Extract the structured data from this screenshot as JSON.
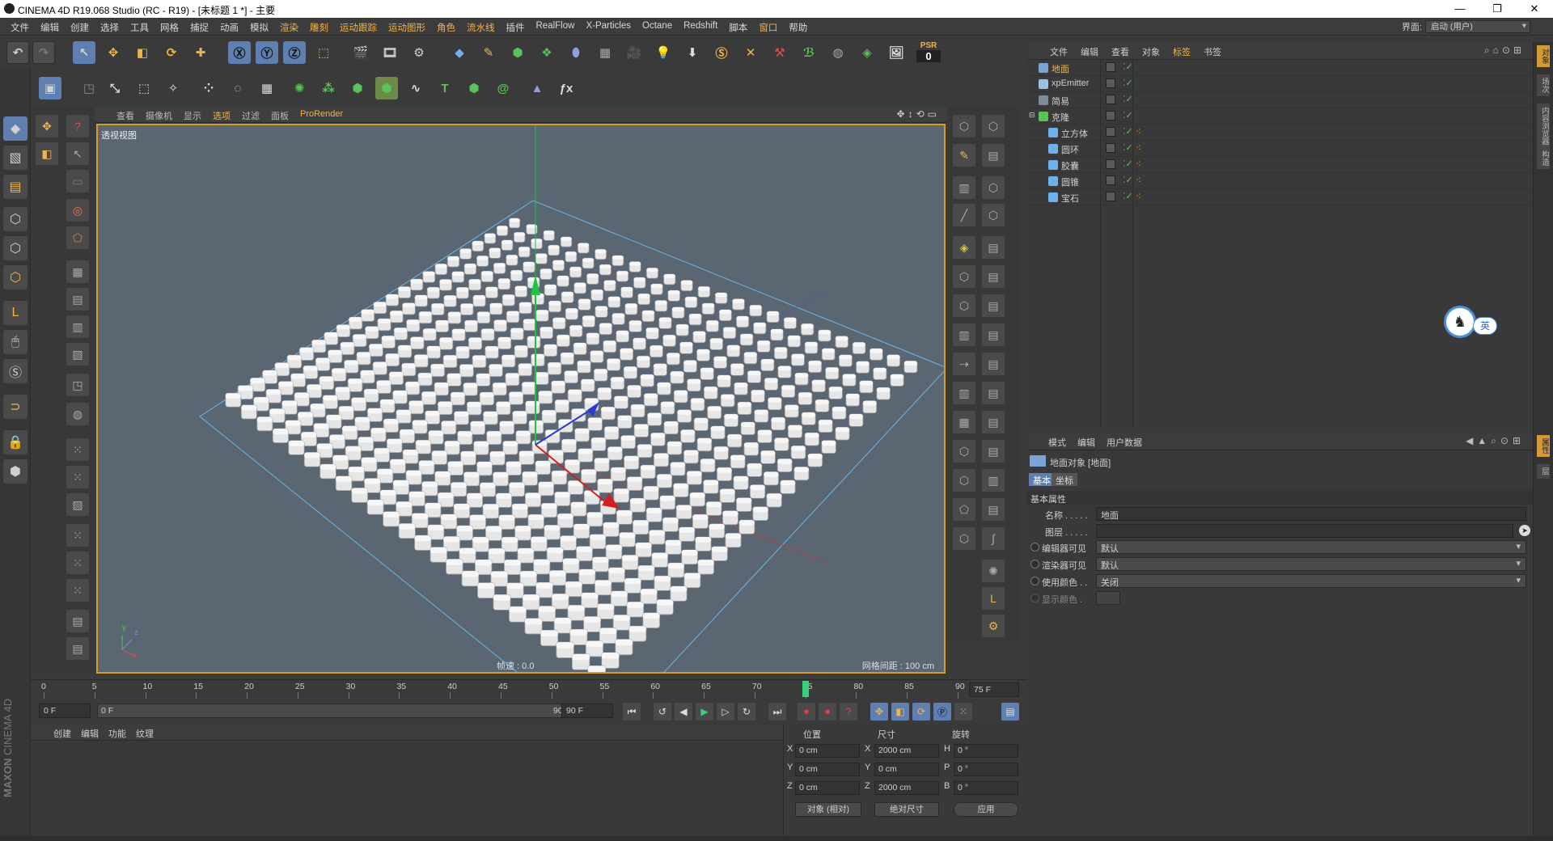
{
  "window": {
    "title": "CINEMA 4D R19.068 Studio (RC - R19) - [未标题 1 *] - 主要",
    "min": "—",
    "max": "❐",
    "close": "✕"
  },
  "menu": {
    "items": [
      "文件",
      "编辑",
      "创建",
      "选择",
      "工具",
      "网格",
      "捕捉",
      "动画",
      "模拟",
      "渲染",
      "雕刻",
      "运动跟踪",
      "运动图形",
      "角色",
      "流水线",
      "插件",
      "RealFlow",
      "X-Particles",
      "Octane",
      "Redshift",
      "脚本",
      "窗口",
      "帮助"
    ],
    "interface_label": "界面:",
    "interface_value": "启动 (用户)"
  },
  "toolbar": {
    "psr_label": "PSR",
    "psr_value": "0"
  },
  "viewport": {
    "menu": [
      "查看",
      "摄像机",
      "显示",
      "选项",
      "过滤",
      "面板",
      "ProRender"
    ],
    "label": "透视视图",
    "fps": "帧速 : 0.0",
    "grid": "网格间距 : 100 cm",
    "axis_y": "y",
    "axis_z": "z",
    "axis_x": "x"
  },
  "object_manager": {
    "menu": [
      "文件",
      "编辑",
      "查看",
      "对象",
      "标签",
      "书签"
    ],
    "objects": [
      {
        "name": "地面",
        "indent": 0,
        "color": "#7aa5d6"
      },
      {
        "name": "xpEmitter",
        "indent": 0,
        "color": "#9ac3e3"
      },
      {
        "name": "简易",
        "indent": 0,
        "color": "#7e8b9b"
      },
      {
        "name": "克隆",
        "indent": 0,
        "color": "#59c359"
      },
      {
        "name": "立方体",
        "indent": 1,
        "color": "#6fb0e8"
      },
      {
        "name": "圆环",
        "indent": 1,
        "color": "#6fb0e8"
      },
      {
        "name": "胶囊",
        "indent": 1,
        "color": "#6fb0e8"
      },
      {
        "name": "圆锥",
        "indent": 1,
        "color": "#6fb0e8"
      },
      {
        "name": "宝石",
        "indent": 1,
        "color": "#6fb0e8"
      }
    ]
  },
  "attributes": {
    "menu": [
      "模式",
      "编辑",
      "用户数据"
    ],
    "object_title": "地面对象 [地面]",
    "tabs": [
      "基本",
      "坐标"
    ],
    "section": "基本属性",
    "name_label": "名称 . . . . .",
    "name_value": "地面",
    "layer_label": "图层 . . . . .",
    "editor_vis_label": "编辑器可见",
    "editor_vis_value": "默认",
    "render_vis_label": "渲染器可见",
    "render_vis_value": "默认",
    "use_color_label": "使用颜色 . .",
    "use_color_value": "关闭",
    "display_color_label": "显示颜色 ."
  },
  "timeline": {
    "ticks": [
      "0",
      "5",
      "10",
      "15",
      "20",
      "25",
      "30",
      "35",
      "40",
      "45",
      "50",
      "55",
      "60",
      "65",
      "70",
      "75",
      "80",
      "85",
      "90"
    ],
    "current_frame": 75,
    "end_label": "75 F",
    "start_field": "0 F",
    "range_start": "0 F",
    "range_end": "90 F",
    "end_field": "90 F"
  },
  "materials": {
    "menu": [
      "创建",
      "编辑",
      "功能",
      "纹理"
    ],
    "brand_1": "MAXON",
    "brand_2": "CINEMA 4D"
  },
  "coords": {
    "heads": [
      "位置",
      "尺寸",
      "旋转"
    ],
    "rows": [
      {
        "a": "X",
        "pos": "0 cm",
        "b": "X",
        "size": "2000 cm",
        "c": "H",
        "rot": "0 °"
      },
      {
        "a": "Y",
        "pos": "0 cm",
        "b": "Y",
        "size": "0 cm",
        "c": "P",
        "rot": "0 °"
      },
      {
        "a": "Z",
        "pos": "0 cm",
        "b": "Z",
        "size": "2000 cm",
        "c": "B",
        "rot": "0 °"
      }
    ],
    "mode1": "对象 (相对)",
    "mode2": "绝对尺寸",
    "apply": "应用"
  },
  "side_tabs": [
    "对象",
    "场次",
    "内容浏览器",
    "构造",
    "属性",
    "层"
  ],
  "ime": {
    "label": "英"
  },
  "colors": {
    "accent_orange": "#d99a2a",
    "selection_blue": "#5e7fb0",
    "viewport_bg": "#5b6673"
  }
}
